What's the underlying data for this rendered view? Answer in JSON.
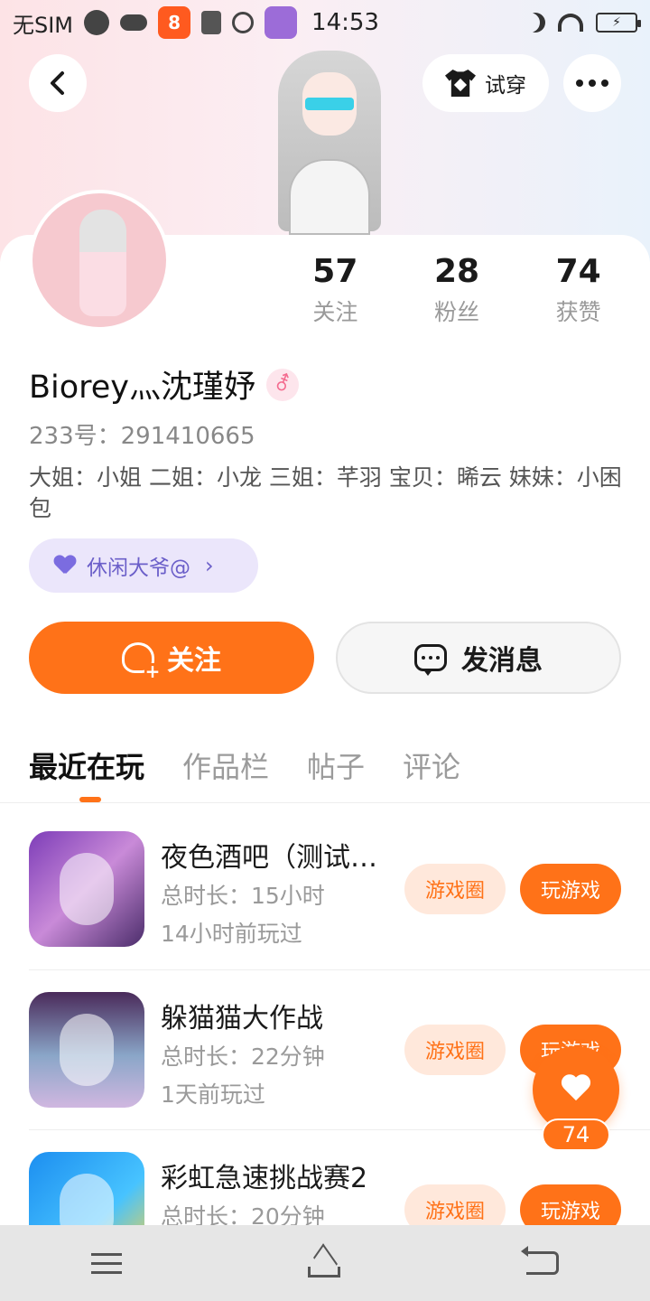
{
  "status_bar": {
    "carrier": "无SIM",
    "time": "14:53",
    "app_glyph": "8"
  },
  "header": {
    "try_on_label": "试穿"
  },
  "profile": {
    "username": "Biorey灬沈瑾妤",
    "gender_symbol": "⚦",
    "id_label": "233号：291410665",
    "bio": "大姐：小姐 二姐：小龙 三姐：芊羽 宝贝：晞云 妹妹：小困包",
    "tag": "休闲大爷@",
    "stats": [
      {
        "value": "57",
        "label": "关注"
      },
      {
        "value": "28",
        "label": "粉丝"
      },
      {
        "value": "74",
        "label": "获赞"
      }
    ]
  },
  "actions": {
    "follow_label": "关注",
    "message_label": "发消息"
  },
  "tabs": [
    {
      "label": "最近在玩",
      "active": true
    },
    {
      "label": "作品栏",
      "active": false
    },
    {
      "label": "帖子",
      "active": false
    },
    {
      "label": "评论",
      "active": false
    }
  ],
  "games": [
    {
      "title": "夜色酒吧（测试…",
      "duration": "总时长：15小时",
      "last_played": "14小时前玩过",
      "circle_label": "游戏圈",
      "play_label": "玩游戏"
    },
    {
      "title": "躲猫猫大作战",
      "duration": "总时长：22分钟",
      "last_played": "1天前玩过",
      "circle_label": "游戏圈",
      "play_label": "玩游戏"
    },
    {
      "title": "彩虹急速挑战赛2",
      "duration": "总时长：20分钟",
      "last_played": "",
      "circle_label": "游戏圈",
      "play_label": "玩游戏"
    }
  ],
  "floating_like": {
    "count": "74"
  },
  "colors": {
    "accent": "#ff7218",
    "tag_bg": "#ebe6fb",
    "tag_text": "#6b5fc9"
  },
  "icons": [
    "back-icon",
    "t-shirt-icon",
    "more-icon",
    "female-gender-icon",
    "heart-icon",
    "follow-heart-icon",
    "chat-icon",
    "like-heart-icon",
    "menu-icon",
    "home-icon",
    "nav-back-icon"
  ]
}
